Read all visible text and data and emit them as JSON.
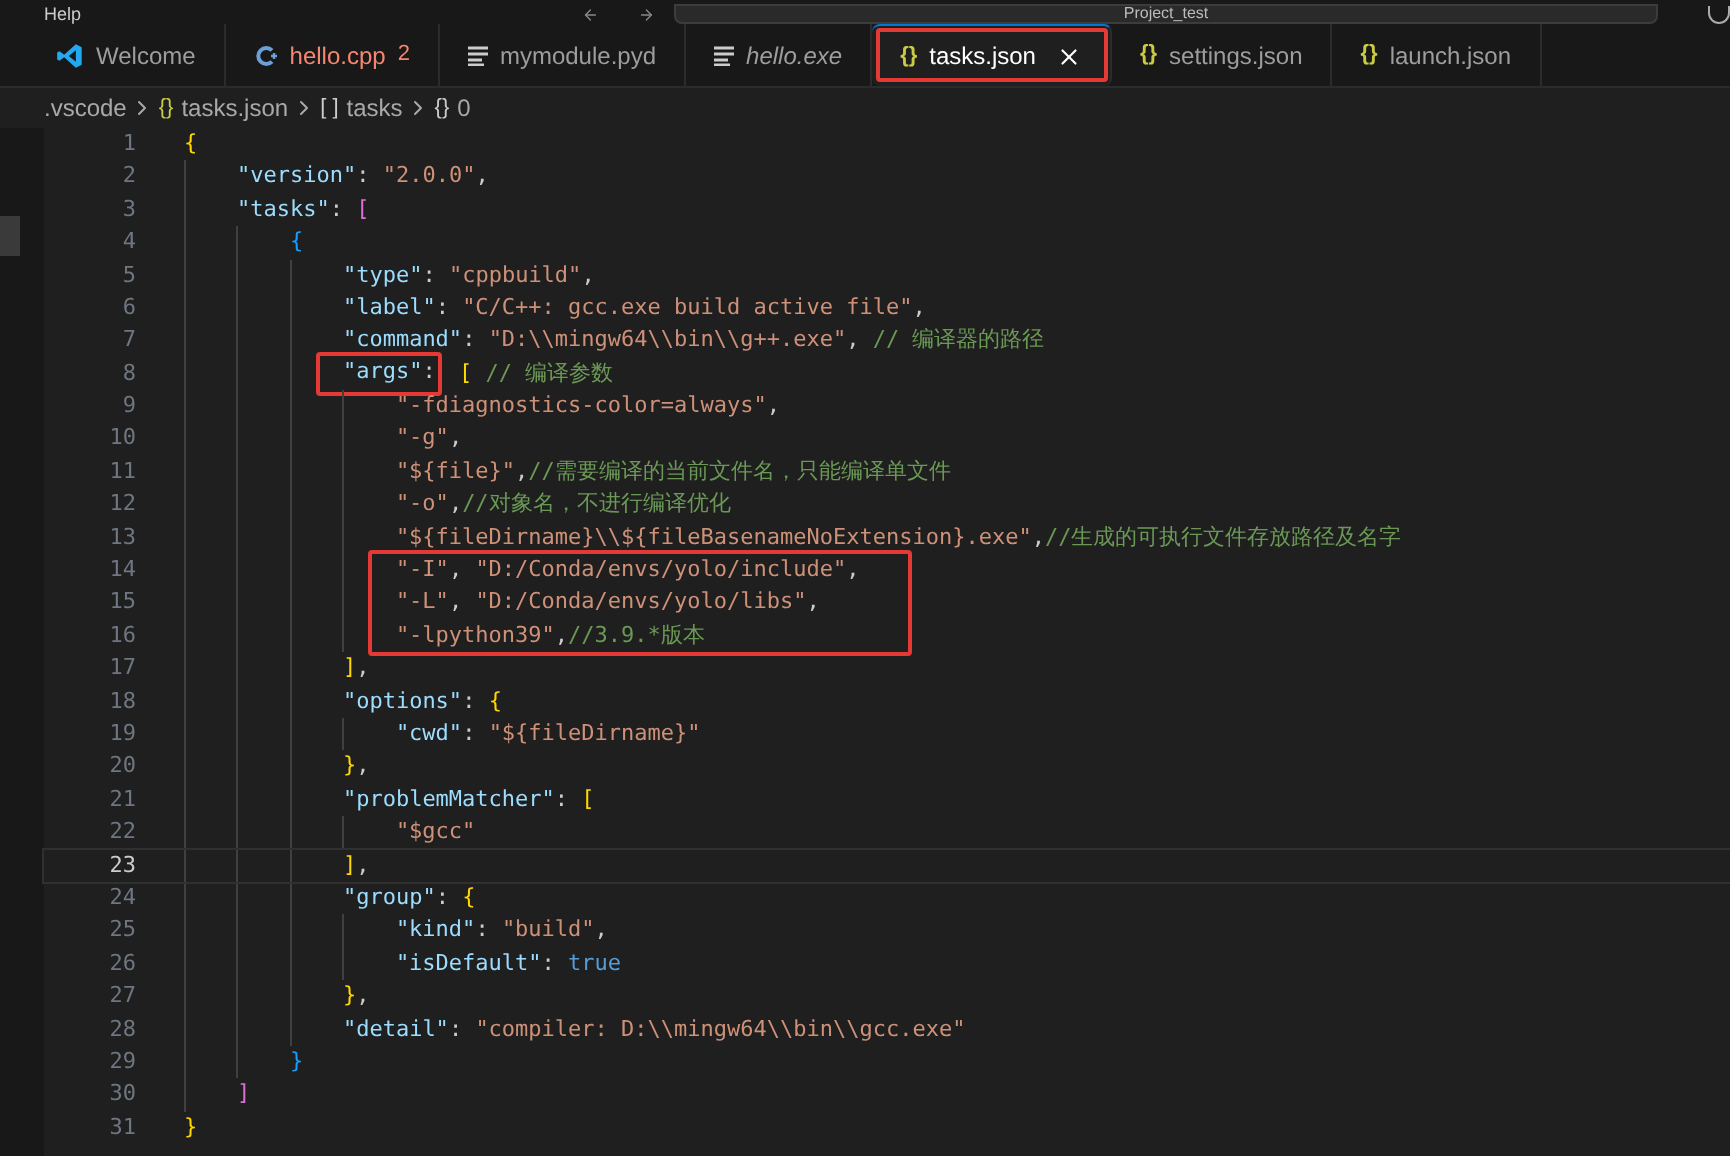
{
  "title_bar": {
    "menu": "Help",
    "search": "Project_test"
  },
  "tabs": [
    {
      "label": "Welcome",
      "kind": "vscode",
      "selected": false,
      "error": false,
      "preview": false,
      "highlighted": false
    },
    {
      "label": "hello.cpp",
      "kind": "cpp",
      "problems": "2",
      "selected": false,
      "error": true,
      "preview": false,
      "highlighted": false
    },
    {
      "label": "mymodule.pyd",
      "kind": "lines",
      "selected": false,
      "error": false,
      "preview": false,
      "highlighted": false
    },
    {
      "label": "hello.exe",
      "kind": "lines",
      "selected": false,
      "error": false,
      "preview": true,
      "highlighted": false
    },
    {
      "label": "tasks.json",
      "kind": "json",
      "glyph": "{}",
      "selected": true,
      "error": false,
      "preview": false,
      "highlighted": true
    },
    {
      "label": "settings.json",
      "kind": "json",
      "glyph": "{}",
      "selected": false,
      "error": false,
      "preview": false,
      "highlighted": false
    },
    {
      "label": "launch.json",
      "kind": "json",
      "glyph": "{}",
      "selected": false,
      "error": false,
      "preview": false,
      "highlighted": false
    }
  ],
  "breadcrumbs": [
    {
      "label": ".vscode"
    },
    {
      "glyph": "{}",
      "label": "tasks.json"
    },
    {
      "glyph": "[ ]",
      "label": "tasks"
    },
    {
      "glyph": "{}",
      "label": "0"
    }
  ],
  "lines": [
    {
      "number": "1",
      "tokens": [
        {
          "kind": "bracket",
          "text": "{",
          "color": "#ffd700"
        }
      ]
    },
    {
      "number": "2",
      "tokens": [
        {
          "kind": "key",
          "text": "    \"version\""
        },
        {
          "kind": "punct",
          "text": ": "
        },
        {
          "kind": "string",
          "text": "\"2.0.0\""
        },
        {
          "kind": "punct",
          "text": ","
        }
      ]
    },
    {
      "number": "3",
      "tokens": [
        {
          "kind": "key",
          "text": "    \"tasks\""
        },
        {
          "kind": "punct",
          "text": ": "
        },
        {
          "kind": "bracket",
          "text": "[",
          "color": "#da70d6"
        }
      ]
    },
    {
      "number": "4",
      "tokens": [
        {
          "kind": "bracket",
          "text": "        {",
          "color": "#179fff"
        }
      ]
    },
    {
      "number": "5",
      "tokens": [
        {
          "kind": "key",
          "text": "            \"type\""
        },
        {
          "kind": "punct",
          "text": ": "
        },
        {
          "kind": "string",
          "text": "\"cppbuild\""
        },
        {
          "kind": "punct",
          "text": ","
        }
      ]
    },
    {
      "number": "6",
      "tokens": [
        {
          "kind": "key",
          "text": "            \"label\""
        },
        {
          "kind": "punct",
          "text": ": "
        },
        {
          "kind": "string",
          "text": "\"C/C++: gcc.exe build active file\""
        },
        {
          "kind": "punct",
          "text": ","
        }
      ]
    },
    {
      "number": "7",
      "tokens": [
        {
          "kind": "key",
          "text": "            \"command\""
        },
        {
          "kind": "punct",
          "text": ": "
        },
        {
          "kind": "string",
          "text": "\"D:\\\\mingw64\\\\bin\\\\g++.exe\""
        },
        {
          "kind": "punct",
          "text": ", "
        },
        {
          "kind": "comment",
          "text": "// 编译器的路径"
        }
      ]
    },
    {
      "number": "8",
      "tokens": [
        {
          "kind": "key",
          "text": "            \"args\"",
          "boxed": true
        },
        {
          "kind": "punct",
          "text": ":",
          "boxed": true
        },
        {
          "kind": "bracket",
          "text": " [",
          "color": "#ffd700"
        },
        {
          "kind": "comment",
          "text": " // 编译参数"
        }
      ]
    },
    {
      "number": "9",
      "tokens": [
        {
          "kind": "string",
          "text": "                \"-fdiagnostics-color=always\""
        },
        {
          "kind": "punct",
          "text": ","
        }
      ]
    },
    {
      "number": "10",
      "tokens": [
        {
          "kind": "string",
          "text": "                \"-g\""
        },
        {
          "kind": "punct",
          "text": ","
        }
      ]
    },
    {
      "number": "11",
      "tokens": [
        {
          "kind": "string",
          "text": "                \"${file}\""
        },
        {
          "kind": "punct",
          "text": ","
        },
        {
          "kind": "comment",
          "text": "//需要编译的当前文件名，只能编译单文件"
        }
      ]
    },
    {
      "number": "12",
      "tokens": [
        {
          "kind": "string",
          "text": "                \"-o\""
        },
        {
          "kind": "punct",
          "text": ","
        },
        {
          "kind": "comment",
          "text": "//对象名，不进行编译优化"
        }
      ]
    },
    {
      "number": "13",
      "tokens": [
        {
          "kind": "string",
          "text": "                \"${fileDirname}\\\\${fileBasenameNoExtension}.exe\""
        },
        {
          "kind": "punct",
          "text": ","
        },
        {
          "kind": "comment",
          "text": "//生成的可执行文件存放路径及名字"
        }
      ]
    },
    {
      "number": "14",
      "boxed": true,
      "tokens": [
        {
          "kind": "string",
          "text": "                \"-I\""
        },
        {
          "kind": "punct",
          "text": ", "
        },
        {
          "kind": "string",
          "text": "\"D:/Conda/envs/yolo/include\""
        },
        {
          "kind": "punct",
          "text": ","
        }
      ]
    },
    {
      "number": "15",
      "boxed": true,
      "tokens": [
        {
          "kind": "string",
          "text": "                \"-L\""
        },
        {
          "kind": "punct",
          "text": ", "
        },
        {
          "kind": "string",
          "text": "\"D:/Conda/envs/yolo/libs\""
        },
        {
          "kind": "punct",
          "text": ","
        }
      ]
    },
    {
      "number": "16",
      "boxed": true,
      "tokens": [
        {
          "kind": "string",
          "text": "                \"-lpython39\""
        },
        {
          "kind": "punct",
          "text": ","
        },
        {
          "kind": "comment",
          "text": "//3.9.*版本"
        }
      ]
    },
    {
      "number": "17",
      "tokens": [
        {
          "kind": "bracket",
          "text": "            ]",
          "color": "#ffd700"
        },
        {
          "kind": "punct",
          "text": ","
        }
      ]
    },
    {
      "number": "18",
      "tokens": [
        {
          "kind": "key",
          "text": "            \"options\""
        },
        {
          "kind": "punct",
          "text": ": "
        },
        {
          "kind": "bracket",
          "text": "{",
          "color": "#ffd700"
        }
      ]
    },
    {
      "number": "19",
      "tokens": [
        {
          "kind": "key",
          "text": "                \"cwd\""
        },
        {
          "kind": "punct",
          "text": ": "
        },
        {
          "kind": "string",
          "text": "\"${fileDirname}\""
        }
      ]
    },
    {
      "number": "20",
      "tokens": [
        {
          "kind": "bracket",
          "text": "            }",
          "color": "#ffd700"
        },
        {
          "kind": "punct",
          "text": ","
        }
      ]
    },
    {
      "number": "21",
      "tokens": [
        {
          "kind": "key",
          "text": "            \"problemMatcher\""
        },
        {
          "kind": "punct",
          "text": ": "
        },
        {
          "kind": "bracket",
          "text": "[",
          "color": "#ffd700"
        }
      ]
    },
    {
      "number": "22",
      "tokens": [
        {
          "kind": "string",
          "text": "                \"$gcc\""
        }
      ]
    },
    {
      "number": "23",
      "current": true,
      "tokens": [
        {
          "kind": "bracket",
          "text": "            ]",
          "color": "#ffd700"
        },
        {
          "kind": "punct",
          "text": ","
        }
      ]
    },
    {
      "number": "24",
      "tokens": [
        {
          "kind": "key",
          "text": "            \"group\""
        },
        {
          "kind": "punct",
          "text": ": "
        },
        {
          "kind": "bracket",
          "text": "{",
          "color": "#ffd700"
        }
      ]
    },
    {
      "number": "25",
      "tokens": [
        {
          "kind": "key",
          "text": "                \"kind\""
        },
        {
          "kind": "punct",
          "text": ": "
        },
        {
          "kind": "string",
          "text": "\"build\""
        },
        {
          "kind": "punct",
          "text": ","
        }
      ]
    },
    {
      "number": "26",
      "tokens": [
        {
          "kind": "key",
          "text": "                \"isDefault\""
        },
        {
          "kind": "punct",
          "text": ": "
        },
        {
          "kind": "bool",
          "text": "true"
        }
      ]
    },
    {
      "number": "27",
      "tokens": [
        {
          "kind": "bracket",
          "text": "            }",
          "color": "#ffd700"
        },
        {
          "kind": "punct",
          "text": ","
        }
      ]
    },
    {
      "number": "28",
      "tokens": [
        {
          "kind": "key",
          "text": "            \"detail\""
        },
        {
          "kind": "punct",
          "text": ": "
        },
        {
          "kind": "string",
          "text": "\"compiler: D:\\\\mingw64\\\\bin\\\\gcc.exe\""
        }
      ]
    },
    {
      "number": "29",
      "tokens": [
        {
          "kind": "bracket",
          "text": "        }",
          "color": "#179fff"
        }
      ]
    },
    {
      "number": "30",
      "tokens": [
        {
          "kind": "bracket",
          "text": "    ]",
          "color": "#da70d6"
        }
      ]
    },
    {
      "number": "31",
      "tokens": [
        {
          "kind": "bracket",
          "text": "}",
          "color": "#ffd700"
        }
      ]
    }
  ]
}
